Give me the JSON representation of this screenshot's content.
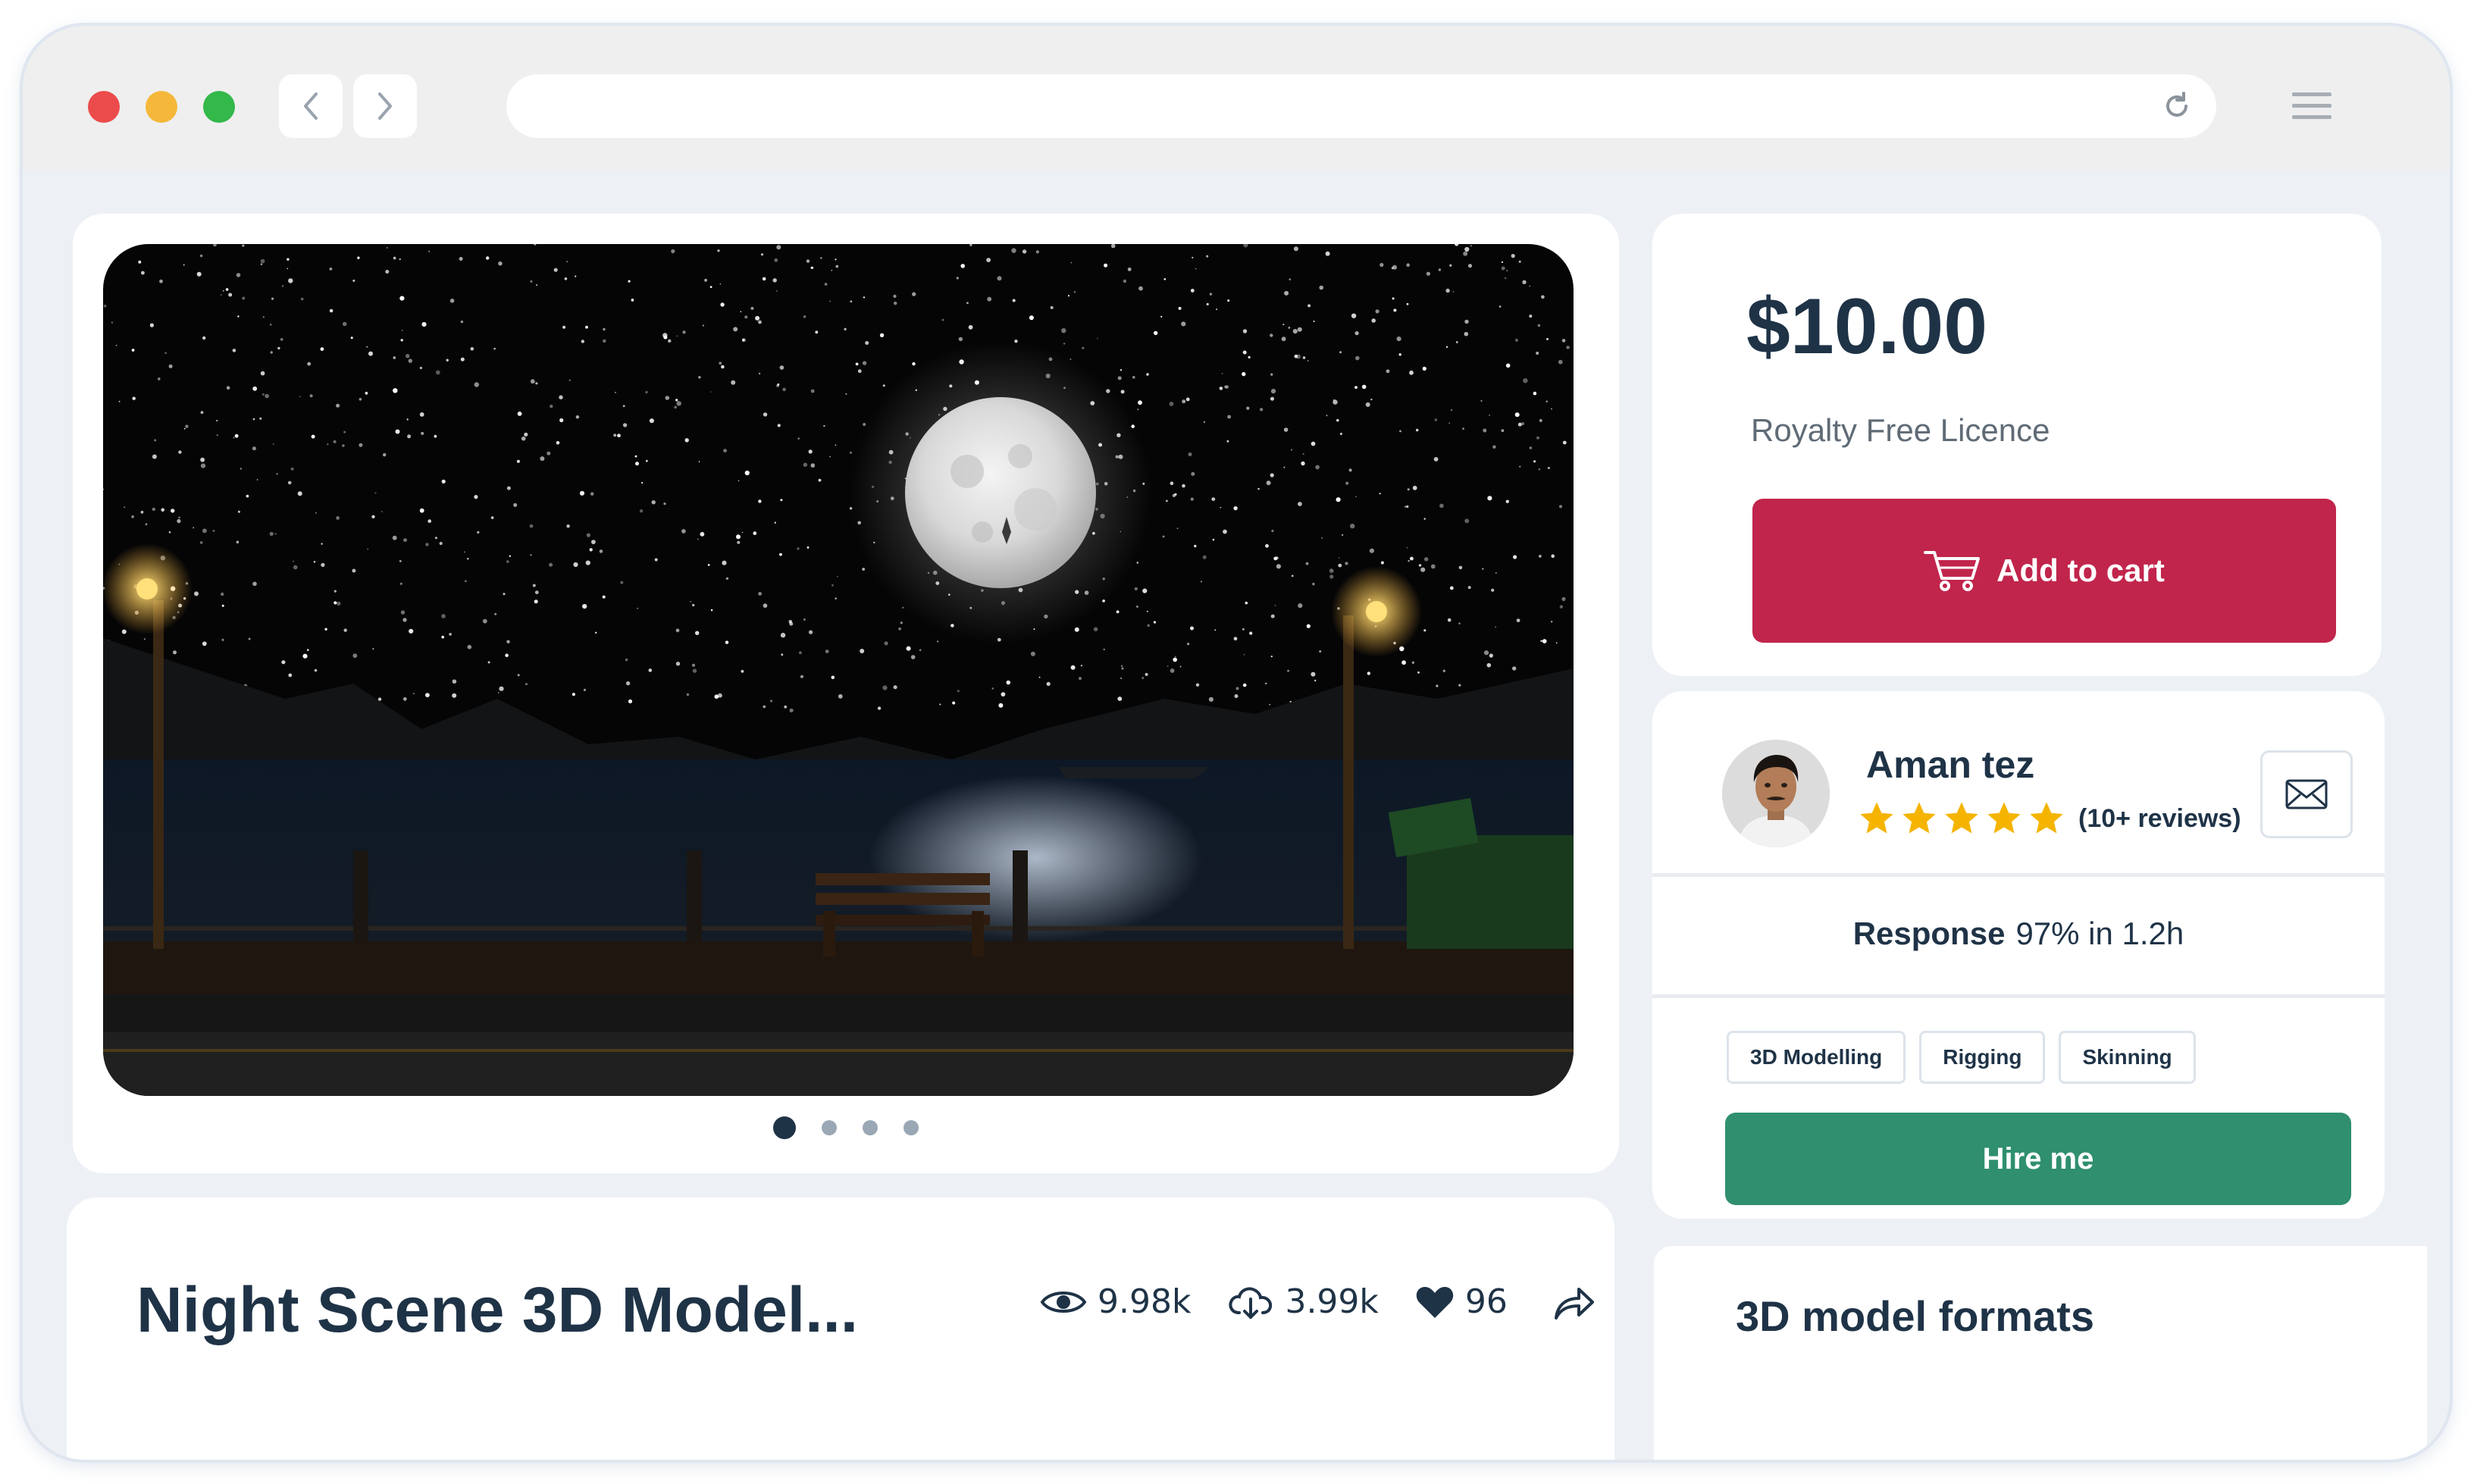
{
  "product": {
    "title": "Night Scene 3D Model...",
    "price": "$10.00",
    "licence": "Royalty Free Licence",
    "add_to_cart_label": "Add to cart",
    "stats": {
      "views": "9.98k",
      "downloads": "3.99k",
      "likes": "96"
    },
    "carousel": {
      "total": 4,
      "active_index": 0
    }
  },
  "seller": {
    "name": "Aman tez",
    "rating_stars": 5,
    "reviews_label": "(10+ reviews)",
    "response_label": "Response",
    "response_value": "97% in 1.2h",
    "skills": [
      "3D Modelling",
      "Rigging",
      "Skinning"
    ],
    "hire_label": "Hire me"
  },
  "formats": {
    "title": "3D model formats"
  },
  "colors": {
    "cart_button": "#c1254c",
    "hire_button": "#2f8f6e",
    "heading_text": "#1f3347",
    "star": "#f5b400",
    "page_background": "#edf1f5"
  },
  "icons": {
    "views": "eye-icon",
    "downloads": "cloud-download-icon",
    "likes": "heart-icon",
    "share": "share-icon",
    "cart": "cart-icon",
    "mail": "mail-icon",
    "menu": "hamburger-menu-icon",
    "reload": "reload-icon"
  }
}
